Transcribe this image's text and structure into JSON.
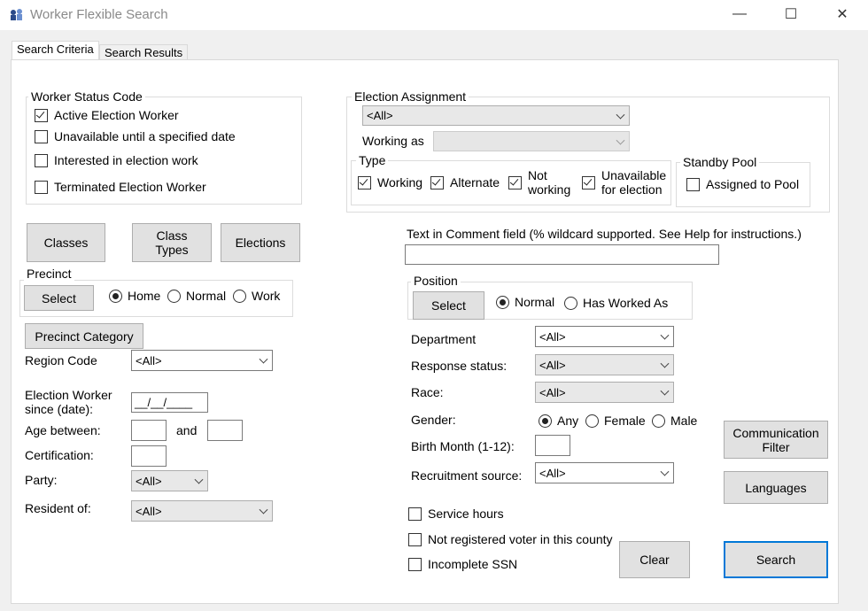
{
  "window": {
    "title": "Worker Flexible Search",
    "minimize": "—",
    "maximize": "☐",
    "close": "✕"
  },
  "tabs": [
    {
      "label": "Search Criteria",
      "active": true
    },
    {
      "label": "Search Results",
      "active": false
    }
  ],
  "worker_status": {
    "title": "Worker Status Code",
    "items": [
      {
        "label": "Active Election Worker",
        "checked": true
      },
      {
        "label": "Unavailable until a specified date",
        "checked": false
      },
      {
        "label": "Interested in election work",
        "checked": false
      },
      {
        "label": "Terminated Election Worker",
        "checked": false
      }
    ]
  },
  "buttons": {
    "classes": "Classes",
    "class_types": "Class Types",
    "elections": "Elections",
    "precinct_select": "Select",
    "precinct_category": "Precinct Category",
    "position_select": "Select",
    "communication_filter": "Communication Filter",
    "languages": "Languages",
    "clear": "Clear",
    "search": "Search"
  },
  "precinct": {
    "title": "Precinct",
    "options": [
      "Home",
      "Normal",
      "Work"
    ],
    "selected": "Home"
  },
  "left_fields": {
    "region_code": {
      "label": "Region Code",
      "value": "<All>"
    },
    "worker_since": {
      "label_line1": "Election Worker",
      "label_line2": "since (date):",
      "value": "__/__/____"
    },
    "age_between": {
      "label": "Age between:",
      "and": "and",
      "from": "",
      "to": ""
    },
    "certification": {
      "label": "Certification:",
      "value": ""
    },
    "party": {
      "label": "Party:",
      "value": "<All>"
    },
    "resident_of": {
      "label": "Resident of:",
      "value": "<All>"
    }
  },
  "election_assignment": {
    "title": "Election Assignment",
    "value": "<All>",
    "working_as_label": "Working as",
    "working_as_value": "",
    "type": {
      "title": "Type",
      "items": [
        {
          "label": "Working",
          "checked": true
        },
        {
          "label": "Alternate",
          "checked": true
        },
        {
          "label_line1": "Not",
          "label_line2": "working",
          "checked": true
        },
        {
          "label_line1": "Unavailable",
          "label_line2": "for election",
          "checked": true
        }
      ]
    },
    "standby_pool": {
      "title": "Standby Pool",
      "label": "Assigned to Pool",
      "checked": false
    }
  },
  "comment": {
    "label": "Text in Comment field (% wildcard supported. See Help for instructions.)",
    "value": ""
  },
  "position": {
    "title": "Position",
    "options": [
      "Normal",
      "Has Worked As"
    ],
    "selected": "Normal"
  },
  "right_fields": {
    "department": {
      "label": "Department",
      "value": "<All>"
    },
    "response_status": {
      "label": "Response status:",
      "value": "<All>"
    },
    "race": {
      "label": "Race:",
      "value": "<All>"
    },
    "gender": {
      "label": "Gender:",
      "options": [
        "Any",
        "Female",
        "Male"
      ],
      "selected": "Any"
    },
    "birth_month": {
      "label": "Birth Month (1-12):",
      "value": ""
    },
    "recruitment_source": {
      "label": "Recruitment source:",
      "value": "<All>"
    }
  },
  "bottom_checks": [
    {
      "label": "Service hours",
      "checked": false
    },
    {
      "label": "Not registered voter in this county",
      "checked": false
    },
    {
      "label": "Incomplete SSN",
      "checked": false
    }
  ]
}
